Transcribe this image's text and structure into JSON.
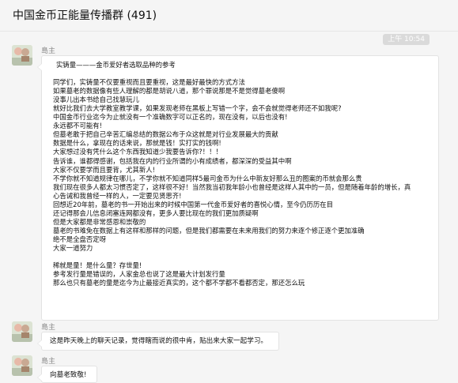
{
  "header": {
    "title": "中国金币正能量传播群 (491)"
  },
  "chat": {
    "timestamp": "上午 10:54",
    "messages": [
      {
        "sender": "島主",
        "lines": [
          "实铸量———金币爱好者选取品种的参考",
          "",
          "同学们，实铸量不仅要重视而且要重视，这是最好最快的方式方法",
          "如果墓老的数据像有些人理解的都是胡说八道，那个罪说那是不是觉得墓老傻啊",
          "没事儿出本书给自己找慧玩儿",
          "就好比我们去大学教室教学课，如果发现老师在黑板上写错一个字，会不会就觉得老师还不如我呢?",
          "中国金币行业迄今为止就没有一个准确数字可以正名的，现在没有，以后也没有!",
          "永远都不可能有!",
          "但墓老敢于把自己辛苦汇编总结的数据公布于众这就是对行业发展最大的贡献",
          "数据是什么，拿现在的话来说，那就是钱！实打实的钱啊!",
          "大家想过没有凭什么这个东西我知道少我要告诉你?！！！",
          "告诉谁，谁都得感谢，包括我在内的行业所谓的小有成绩者，都深深的受益其中啊",
          "大家不仅要学而且要背，尤其新人!",
          "不学你就不知道规律在哪儿，不学你就不知道同样5最司金币为什么中新友好那么丑的图案的币就会那么贵",
          "我们现在很多人都太习惯否定了，这样很不好！当然我当初我年龄小也曾经是这样人其中的一员，但是随着年龄的增长，真",
          "心告诫和我曾经一样的人，一定要见贤思齐!",
          "回想近20年前，墓老的书一开始出来的时候中国第一代金币爱好者的喜悦心情，至今仍历历在目",
          "还记得那会儿信息闭塞连网都没有，更多人要比现在的我们更加质疑啊",
          "但是大家都是非常感恩和崇敬的",
          "墓老的书难免在数据上有这样和那样的问题，但是我们都需要在未来用我们的努力来逐个修正逐个更加准确",
          "绝不是全盘否定呀",
          "大家一道努力",
          "",
          "稀就是量！是什么量？存世量!",
          "参考发行量是错误的，人家金总也说了这是最大计划发行量",
          "那么也只有墓老的量是迄今为止最接近真实的，这个都不学都不看都否定，那还怎么玩"
        ]
      },
      {
        "sender": "島主",
        "text": "这是昨天晚上的聊天记录，觉得瞎而说的很中肯，贴出来大家一起学习。"
      },
      {
        "sender": "島主",
        "text": "向墓老致敬!"
      }
    ]
  }
}
